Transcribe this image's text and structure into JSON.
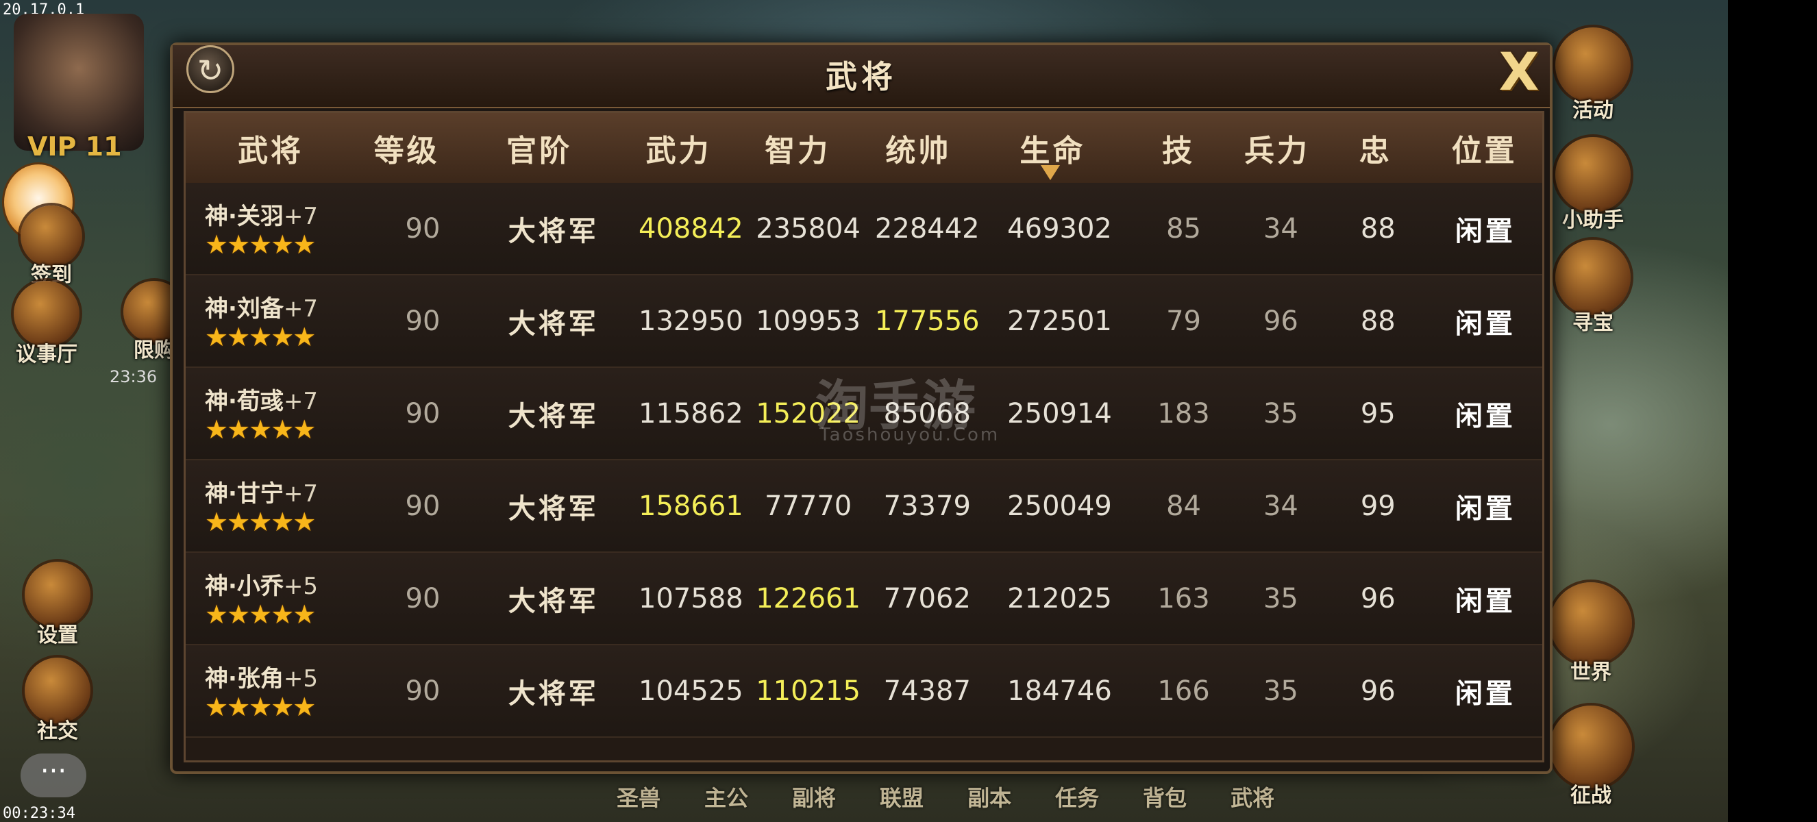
{
  "status": {
    "version": "20.17.0.1",
    "clock": "00:23:34"
  },
  "player": {
    "vip": "VIP 11"
  },
  "left_menu": [
    {
      "label": "签到"
    },
    {
      "label": "议事厅"
    },
    {
      "label": "限购"
    },
    {
      "label": "设置"
    },
    {
      "label": "社交"
    }
  ],
  "left_timer": "23:36",
  "right_menu": [
    {
      "label": "活动"
    },
    {
      "label": "小助手"
    },
    {
      "label": "寻宝"
    },
    {
      "label": "世界"
    },
    {
      "label": "征战"
    }
  ],
  "bottom_nav": [
    "圣兽",
    "主公",
    "副将",
    "联盟",
    "副本",
    "任务",
    "背包",
    "武将"
  ],
  "chat_button": "···",
  "dialog": {
    "title": "武将",
    "refresh_icon": "↻",
    "close_icon": "X"
  },
  "table": {
    "headers": [
      "武将",
      "等级",
      "官阶",
      "武力",
      "智力",
      "统帅",
      "生命",
      "技",
      "兵力",
      "忠",
      "位置"
    ],
    "sort_column": "生命",
    "rows": [
      {
        "name": "神·关羽",
        "plus": "+7",
        "stars": "★★★★★",
        "level": "90",
        "rank": "大将军",
        "force": "408842",
        "intel": "235804",
        "command": "228442",
        "life": "469302",
        "skill": "85",
        "troops": "34",
        "loyalty": "88",
        "position": "闲置",
        "highlight": "force"
      },
      {
        "name": "神·刘备",
        "plus": "+7",
        "stars": "★★★★★",
        "level": "90",
        "rank": "大将军",
        "force": "132950",
        "intel": "109953",
        "command": "177556",
        "life": "272501",
        "skill": "79",
        "troops": "96",
        "loyalty": "88",
        "position": "闲置",
        "highlight": "command"
      },
      {
        "name": "神·荀彧",
        "plus": "+7",
        "stars": "★★★★★",
        "level": "90",
        "rank": "大将军",
        "force": "115862",
        "intel": "152022",
        "command": "85068",
        "life": "250914",
        "skill": "183",
        "troops": "35",
        "loyalty": "95",
        "position": "闲置",
        "highlight": "intel"
      },
      {
        "name": "神·甘宁",
        "plus": "+7",
        "stars": "★★★★★",
        "level": "90",
        "rank": "大将军",
        "force": "158661",
        "intel": "77770",
        "command": "73379",
        "life": "250049",
        "skill": "84",
        "troops": "34",
        "loyalty": "99",
        "position": "闲置",
        "highlight": "force"
      },
      {
        "name": "神·小乔",
        "plus": "+5",
        "stars": "★★★★★",
        "level": "90",
        "rank": "大将军",
        "force": "107588",
        "intel": "122661",
        "command": "77062",
        "life": "212025",
        "skill": "163",
        "troops": "35",
        "loyalty": "96",
        "position": "闲置",
        "highlight": "intel"
      },
      {
        "name": "神·张角",
        "plus": "+5",
        "stars": "★★★★★",
        "level": "90",
        "rank": "大将军",
        "force": "104525",
        "intel": "110215",
        "command": "74387",
        "life": "184746",
        "skill": "166",
        "troops": "35",
        "loyalty": "96",
        "position": "闲置",
        "highlight": "intel"
      }
    ]
  },
  "watermark": {
    "main": "淘手游",
    "sub": "Taoshouyou.Com"
  },
  "colors": {
    "highlight": "#f4ee58",
    "star": "#f8b61a",
    "header_bg": "#5a3e2a"
  }
}
